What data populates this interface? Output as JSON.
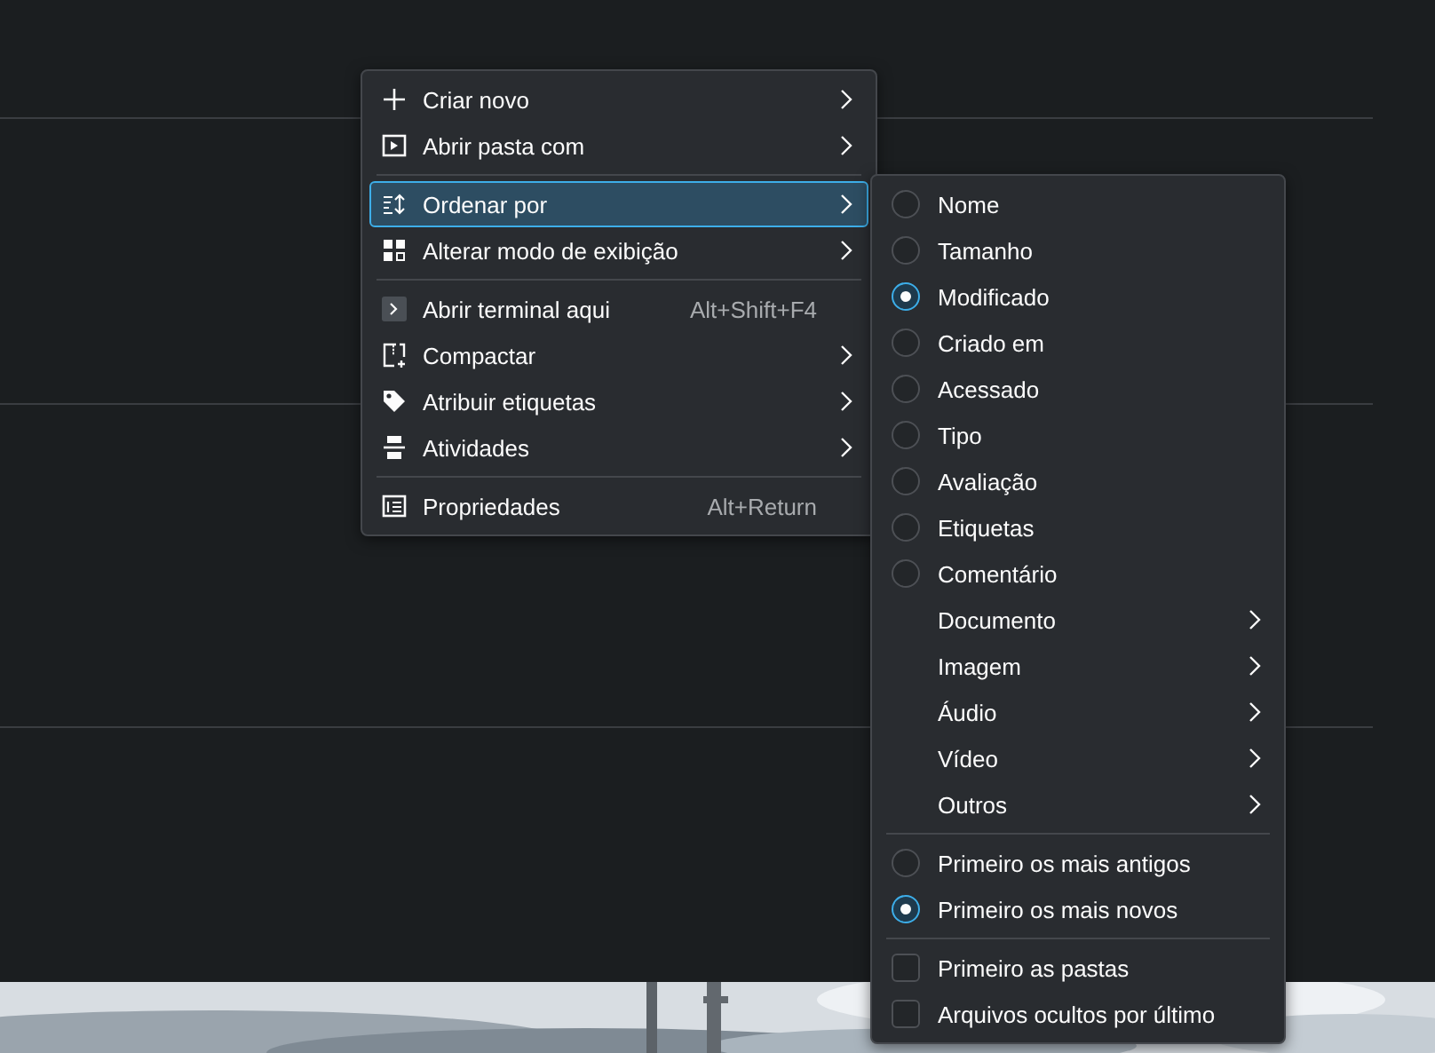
{
  "context_menu": {
    "items": [
      {
        "kind": "item",
        "label": "Criar novo",
        "submenu": true,
        "highlighted": false
      },
      {
        "kind": "item",
        "label": "Abrir pasta com",
        "submenu": true,
        "highlighted": false
      },
      {
        "kind": "separator"
      },
      {
        "kind": "item",
        "label": "Ordenar por",
        "submenu": true,
        "highlighted": true
      },
      {
        "kind": "item",
        "label": "Alterar modo de exibição",
        "submenu": true,
        "highlighted": false
      },
      {
        "kind": "separator"
      },
      {
        "kind": "item",
        "label": "Abrir terminal aqui",
        "shortcut": "Alt+Shift+F4",
        "submenu": false,
        "highlighted": false
      },
      {
        "kind": "item",
        "label": "Compactar",
        "submenu": true,
        "highlighted": false
      },
      {
        "kind": "item",
        "label": "Atribuir etiquetas",
        "submenu": true,
        "highlighted": false
      },
      {
        "kind": "item",
        "label": "Atividades",
        "submenu": true,
        "highlighted": false
      },
      {
        "kind": "separator"
      },
      {
        "kind": "item",
        "label": "Propriedades",
        "shortcut": "Alt+Return",
        "submenu": false,
        "highlighted": false
      }
    ]
  },
  "sort_submenu": {
    "items": [
      {
        "kind": "radio",
        "label": "Nome",
        "selected": false
      },
      {
        "kind": "radio",
        "label": "Tamanho",
        "selected": false
      },
      {
        "kind": "radio",
        "label": "Modificado",
        "selected": true
      },
      {
        "kind": "radio",
        "label": "Criado em",
        "selected": false
      },
      {
        "kind": "radio",
        "label": "Acessado",
        "selected": false
      },
      {
        "kind": "radio",
        "label": "Tipo",
        "selected": false
      },
      {
        "kind": "radio",
        "label": "Avaliação",
        "selected": false
      },
      {
        "kind": "radio",
        "label": "Etiquetas",
        "selected": false
      },
      {
        "kind": "radio",
        "label": "Comentário",
        "selected": false
      },
      {
        "kind": "submenu",
        "label": "Documento"
      },
      {
        "kind": "submenu",
        "label": "Imagem"
      },
      {
        "kind": "submenu",
        "label": "Áudio"
      },
      {
        "kind": "submenu",
        "label": "Vídeo"
      },
      {
        "kind": "submenu",
        "label": "Outros"
      },
      {
        "kind": "separator"
      },
      {
        "kind": "radio",
        "label": "Primeiro os mais antigos",
        "selected": false
      },
      {
        "kind": "radio",
        "label": "Primeiro os mais novos",
        "selected": true
      },
      {
        "kind": "separator"
      },
      {
        "kind": "checkbox",
        "label": "Primeiro as pastas",
        "checked": false
      },
      {
        "kind": "checkbox",
        "label": "Arquivos ocultos por último",
        "checked": false
      }
    ]
  }
}
